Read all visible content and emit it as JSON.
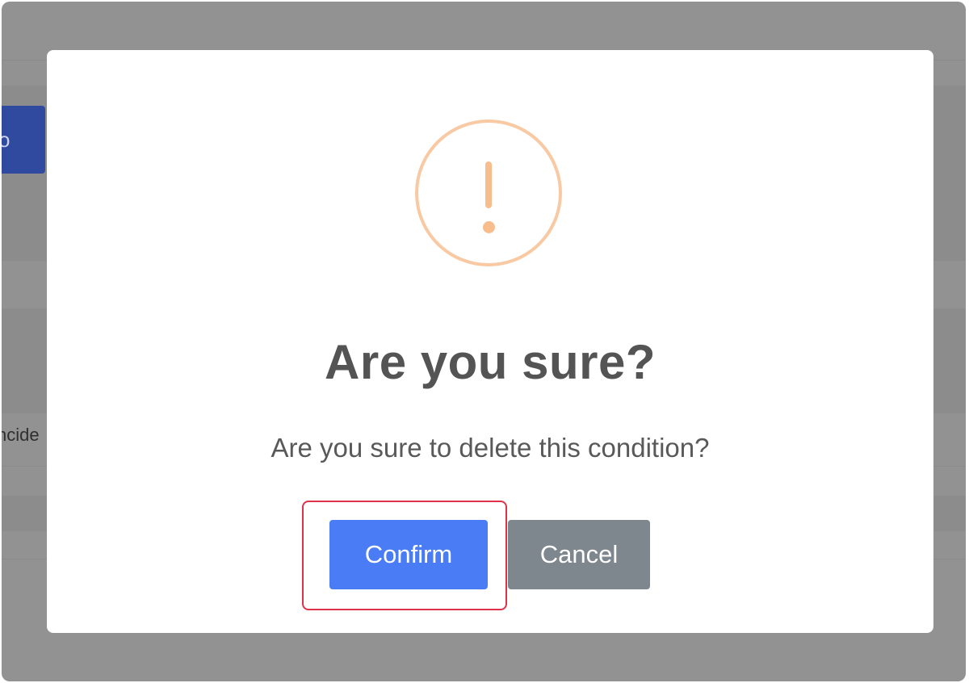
{
  "background": {
    "button_fragment": "o",
    "text_fragment": "ncide"
  },
  "dialog": {
    "icon": "warning-exclamation-icon",
    "title": "Are you sure?",
    "message": "Are you sure to delete this condition?",
    "confirm_label": "Confirm",
    "cancel_label": "Cancel"
  },
  "colors": {
    "overlay": "#929292",
    "warning_icon": "#f8bb86",
    "confirm_button": "#4a7cf6",
    "cancel_button": "#7e868e",
    "highlight_border": "#e0314b"
  }
}
